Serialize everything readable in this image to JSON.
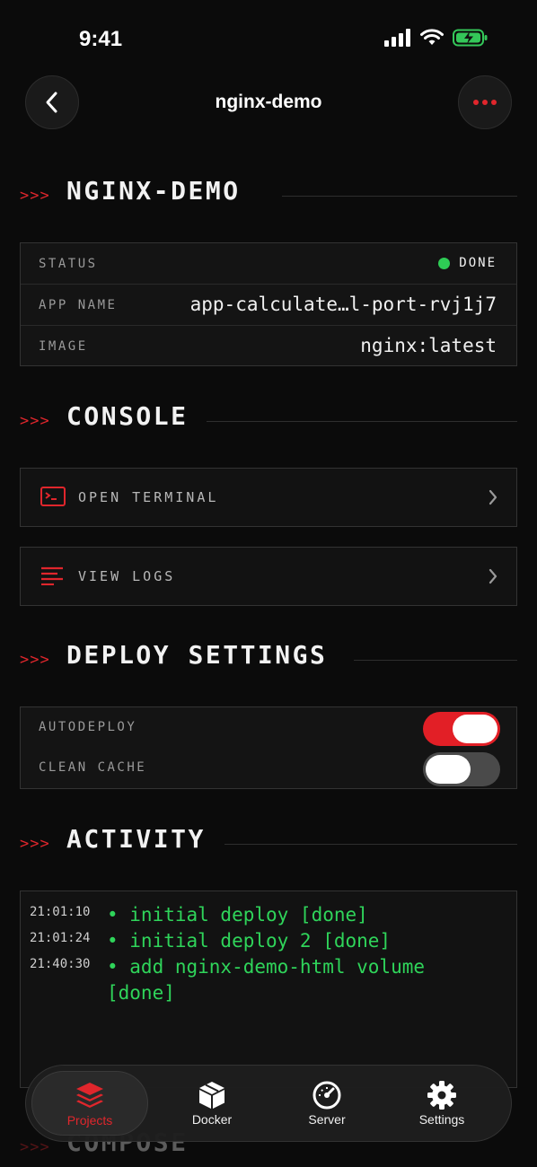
{
  "status_bar": {
    "time": "9:41"
  },
  "header": {
    "title": "nginx-demo"
  },
  "sections": {
    "arrows": ">>>",
    "app_title": "NGINX-DEMO",
    "console": "CONSOLE",
    "deploy_settings": "DEPLOY SETTINGS",
    "activity": "ACTIVITY",
    "compose": "COMPOSE"
  },
  "info": {
    "status_label": "STATUS",
    "status_value": "DONE",
    "app_name_label": "APP NAME",
    "app_name_value": "app-calculate…l-port-rvj1j7",
    "image_label": "IMAGE",
    "image_value": "nginx:latest"
  },
  "console": {
    "open_terminal": "OPEN TERMINAL",
    "view_logs": "VIEW LOGS"
  },
  "deploy": {
    "autodeploy_label": "AUTODEPLOY",
    "autodeploy_on": true,
    "clean_cache_label": "CLEAN CACHE",
    "clean_cache_on": false
  },
  "activity": [
    {
      "time": "21:01:10",
      "message": "• initial deploy [done]"
    },
    {
      "time": "21:01:24",
      "message": "• initial deploy 2 [done]"
    },
    {
      "time": "21:40:30",
      "message": "• add nginx-demo-html volume [done]"
    }
  ],
  "tabs": [
    {
      "label": "Projects",
      "icon": "layers-icon",
      "active": true
    },
    {
      "label": "Docker",
      "icon": "box-icon",
      "active": false
    },
    {
      "label": "Server",
      "icon": "gauge-icon",
      "active": false
    },
    {
      "label": "Settings",
      "icon": "gear-icon",
      "active": false
    }
  ],
  "colors": {
    "accent": "#e0262c",
    "success": "#2ecc55",
    "log_text": "#2fd45a",
    "background": "#0b0b0b"
  }
}
